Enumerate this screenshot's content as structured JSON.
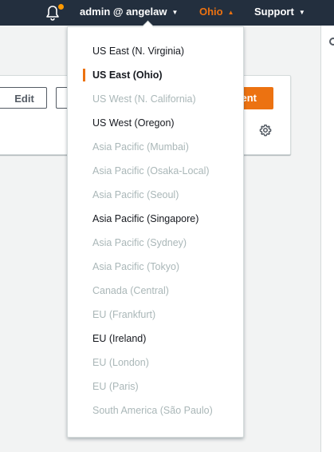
{
  "topbar": {
    "user_label": "admin @ angelaw",
    "region_label": "Ohio",
    "support_label": "Support",
    "notification_dot_color": "#ff9900",
    "accent_color": "#ec7211",
    "bell_icon": "bell-icon"
  },
  "content": {
    "edit_label": "Edit",
    "primary_button_label": "ent",
    "settings_icon": "gear-icon"
  },
  "regions": [
    {
      "label": "US East (N. Virginia)",
      "state": "enabled"
    },
    {
      "label": "US East (Ohio)",
      "state": "selected"
    },
    {
      "label": "US West (N. California)",
      "state": "disabled"
    },
    {
      "label": "US West (Oregon)",
      "state": "enabled"
    },
    {
      "label": "Asia Pacific (Mumbai)",
      "state": "disabled"
    },
    {
      "label": "Asia Pacific (Osaka-Local)",
      "state": "disabled"
    },
    {
      "label": "Asia Pacific (Seoul)",
      "state": "disabled"
    },
    {
      "label": "Asia Pacific (Singapore)",
      "state": "enabled"
    },
    {
      "label": "Asia Pacific (Sydney)",
      "state": "disabled"
    },
    {
      "label": "Asia Pacific (Tokyo)",
      "state": "disabled"
    },
    {
      "label": "Canada (Central)",
      "state": "disabled"
    },
    {
      "label": "EU (Frankfurt)",
      "state": "disabled"
    },
    {
      "label": "EU (Ireland)",
      "state": "enabled"
    },
    {
      "label": "EU (London)",
      "state": "disabled"
    },
    {
      "label": "EU (Paris)",
      "state": "disabled"
    },
    {
      "label": "South America (São Paulo)",
      "state": "disabled"
    }
  ]
}
